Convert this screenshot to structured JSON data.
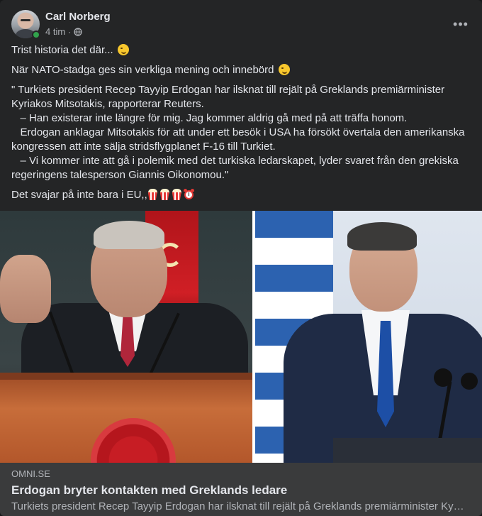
{
  "post": {
    "author": "Carl Norberg",
    "timestamp": "4 tim",
    "separator": "·",
    "audience_icon": "globe-icon",
    "more_options_icon": "more-horizontal-icon",
    "more_label": "•••",
    "online": true
  },
  "content": {
    "line1": "Trist historia det där...",
    "line2": "När NATO-stadga ges sin verkliga mening och innebörd",
    "quote_line1": "\" Turkiets president Recep Tayyip Erdogan har ilsknat till rejält på Greklands premiärminister",
    "quote_line2": "Kyriakos Mitsotakis, rapporterar Reuters.",
    "quote_line3": "   – Han existerar inte längre för mig. Jag kommer aldrig gå med på att träffa honom.",
    "quote_line4": "   Erdogan anklagar Mitsotakis för att under ett besök i USA ha försökt övertala den amerikanska",
    "quote_line5": "kongressen att inte sälja stridsflygplanet F-16 till Turkiet.",
    "quote_line6": "   – Vi kommer inte att gå i polemik med det turkiska ledarskapet, lyder svaret från den grekiska",
    "quote_line7": "regeringens talesperson Giannis Oikonomou.\"",
    "line_last": "Det svajar på inte bara i EU,,",
    "emojis": [
      "winking-face",
      "winking-face",
      "popcorn",
      "popcorn",
      "popcorn",
      "alarm-clock"
    ]
  },
  "link_preview": {
    "domain": "OMNI.SE",
    "title": "Erdogan bryter kontakten med Greklands ledare",
    "description": "Turkiets president Recep Tayyip Erdogan har ilsknat till rejält på Greklands premiärminister Kyriakos Mitsotakis, rapporterar Reuters."
  },
  "colors": {
    "background": "#242526",
    "text_primary": "#e4e6eb",
    "text_secondary": "#b0b3b8",
    "link_footer": "#3a3b3c",
    "online": "#31a24c"
  }
}
